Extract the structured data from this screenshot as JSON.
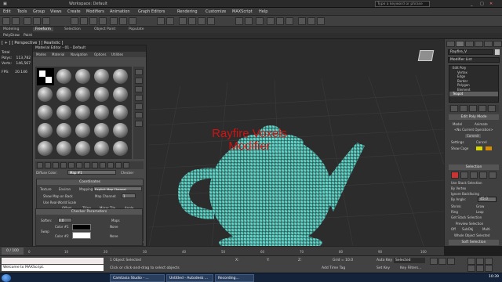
{
  "window": {
    "title": "Workspace: Default",
    "search_placeholder": "Type a keyword or phrase"
  },
  "menu": [
    "Edit",
    "Tools",
    "Group",
    "Views",
    "Create",
    "Modifiers",
    "Animation",
    "Graph Editors",
    "Rendering",
    "Customize",
    "MAXScript",
    "Help"
  ],
  "ribbon": {
    "tabs": [
      "Modeling",
      "Freeform",
      "Selection",
      "Object Paint",
      "Populate"
    ],
    "active_index": 1,
    "sub": [
      "PolyDraw",
      "Paint"
    ]
  },
  "viewport": {
    "label": "[ + ] [ Perspective ] [ Realistic ]",
    "stats": [
      {
        "label": "Total",
        "value": ""
      },
      {
        "label": "Polys:",
        "value": "113,782"
      },
      {
        "label": "Verts:",
        "value": "146,567"
      },
      {
        "label": "FPS:",
        "value": "20.146"
      }
    ],
    "overlay_text": [
      "Rayfire Voxels",
      "Modifier"
    ],
    "teapot_color": "#4fd4c8",
    "overlay_color": "#d31212"
  },
  "material_editor": {
    "title": "Material Editor - 01 - Default",
    "menu": [
      "Modes",
      "Material",
      "Navigation",
      "Options",
      "Utilities"
    ],
    "material_name": "Map #1",
    "material_type": "Checker",
    "offset_label": "Diffuse Color:",
    "coordinates": {
      "header": "Coordinates",
      "texture": "Texture",
      "environ": "Environ",
      "mapping_label": "Mapping:",
      "mapping_value": "Explicit Map Channel",
      "show_map_label": "Show Map on Back",
      "map_channel_label": "Map Channel:",
      "map_channel_value": "1",
      "real_world": "Use Real-World Scale",
      "offset": "Offset",
      "tiling": "Tiling",
      "mirror_tile": "Mirror Tile",
      "angle": "Angle",
      "u": "U:",
      "v": "V:",
      "w": "W:",
      "u_vals": [
        "0.0",
        "1.0",
        "0.0"
      ],
      "v_vals": [
        "0.0",
        "1.0",
        "0.0"
      ],
      "w_val": "0.0",
      "uv": "UV",
      "vw": "VW",
      "wu": "WU",
      "blur_label": "Blur:",
      "blur_value": "1.0",
      "blur_offset_label": "Blur offset:",
      "blur_offset_value": "0.0",
      "rotate": "Rotate"
    },
    "noise_header": "Noise",
    "checker": {
      "header": "Checker Parameters",
      "soften_label": "Soften:",
      "soften_value": "0.0",
      "maps_label": "Maps",
      "swap_label": "Swap",
      "color1_label": "Color #1",
      "color2_label": "Color #2",
      "none1": "None",
      "none2": "None"
    }
  },
  "command_panel": {
    "object_name": "Rayfire_V",
    "modifier_list": "Modifier List",
    "stack": [
      {
        "label": "Edit Poly",
        "selected": false
      },
      {
        "label": "Vertex",
        "selected": false
      },
      {
        "label": "Edge",
        "selected": false
      },
      {
        "label": "Border",
        "selected": false
      },
      {
        "label": "Polygon",
        "selected": false
      },
      {
        "label": "Element",
        "selected": false
      },
      {
        "label": "Teapot",
        "selected": true
      }
    ],
    "edit_poly_mode": "Edit Poly Mode",
    "model_label": "Model",
    "animate_label": "Animate",
    "no_operation": "<No Current Operation>",
    "commit": "Commit",
    "settings": "Settings",
    "cancel": "Cancel",
    "show_cage": "Show Cage",
    "selection_header": "Selection",
    "use_stack": "Use Stack Selection",
    "by_vertex": "By Vertex",
    "ignore_backfacing": "Ignore Backfacing",
    "by_angle_label": "By Angle:",
    "by_angle_value": "45.0",
    "shrink": "Shrink",
    "grow": "Grow",
    "ring": "Ring",
    "loop": "Loop",
    "get_stack": "Get Stack Selection",
    "preview_header": "Preview Selection",
    "off": "Off",
    "subobj": "SubObj",
    "multi": "Multi",
    "whole_selected": "Whole Object Selected",
    "soft_selection": "Soft Selection"
  },
  "timeline": {
    "frame_display": "0 / 100",
    "ticks": [
      "0",
      "10",
      "20",
      "30",
      "40",
      "50",
      "60",
      "70",
      "80",
      "90",
      "100"
    ]
  },
  "status": {
    "maxscript_line": "Welcome to MAXScript.",
    "objects_selected": "1 Object Selected",
    "hint": "Click or click-and-drag to select objects",
    "x_label": "X:",
    "y_label": "Y:",
    "z_label": "Z:",
    "grid": "Grid = 10.0",
    "auto_key": "Auto Key",
    "selected": "Selected",
    "set_key": "Set Key",
    "key_filters": "Key Filters...",
    "add_time_tag": "Add Time Tag"
  },
  "taskbar": {
    "items": [
      "Camtasia Studio - ...",
      "Untitled - Autodesk ...",
      "Recording..."
    ],
    "clock": "10:39"
  }
}
